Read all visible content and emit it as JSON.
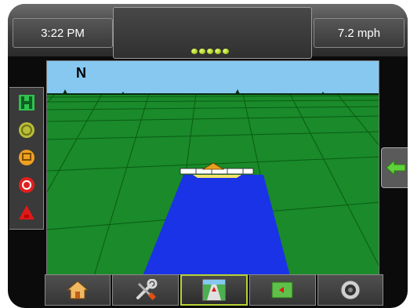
{
  "status": {
    "time": "3:22 PM",
    "speed": "7.2 mph"
  },
  "lightbar": {
    "leds_lit": 5
  },
  "view": {
    "heading_indicator": "N"
  },
  "left_panel": {
    "icons": [
      "guidance-mode-icon",
      "gnss-status-icon",
      "boom-status-icon",
      "master-switch-icon",
      "vehicle-marker-icon"
    ]
  },
  "right_panel": {
    "icon": "green-left-arrow-icon"
  },
  "bottom_nav": {
    "icons": [
      "home-icon",
      "tools-icon",
      "guidance-view-icon",
      "field-view-icon",
      "camera-icon"
    ],
    "active": "guidance-view-icon"
  },
  "colors": {
    "sky": "#86c8f0",
    "field": "#1a8a2a",
    "coverage": "#1a33e6",
    "accent": "#b7d334",
    "arrow": "#5fd13a"
  }
}
